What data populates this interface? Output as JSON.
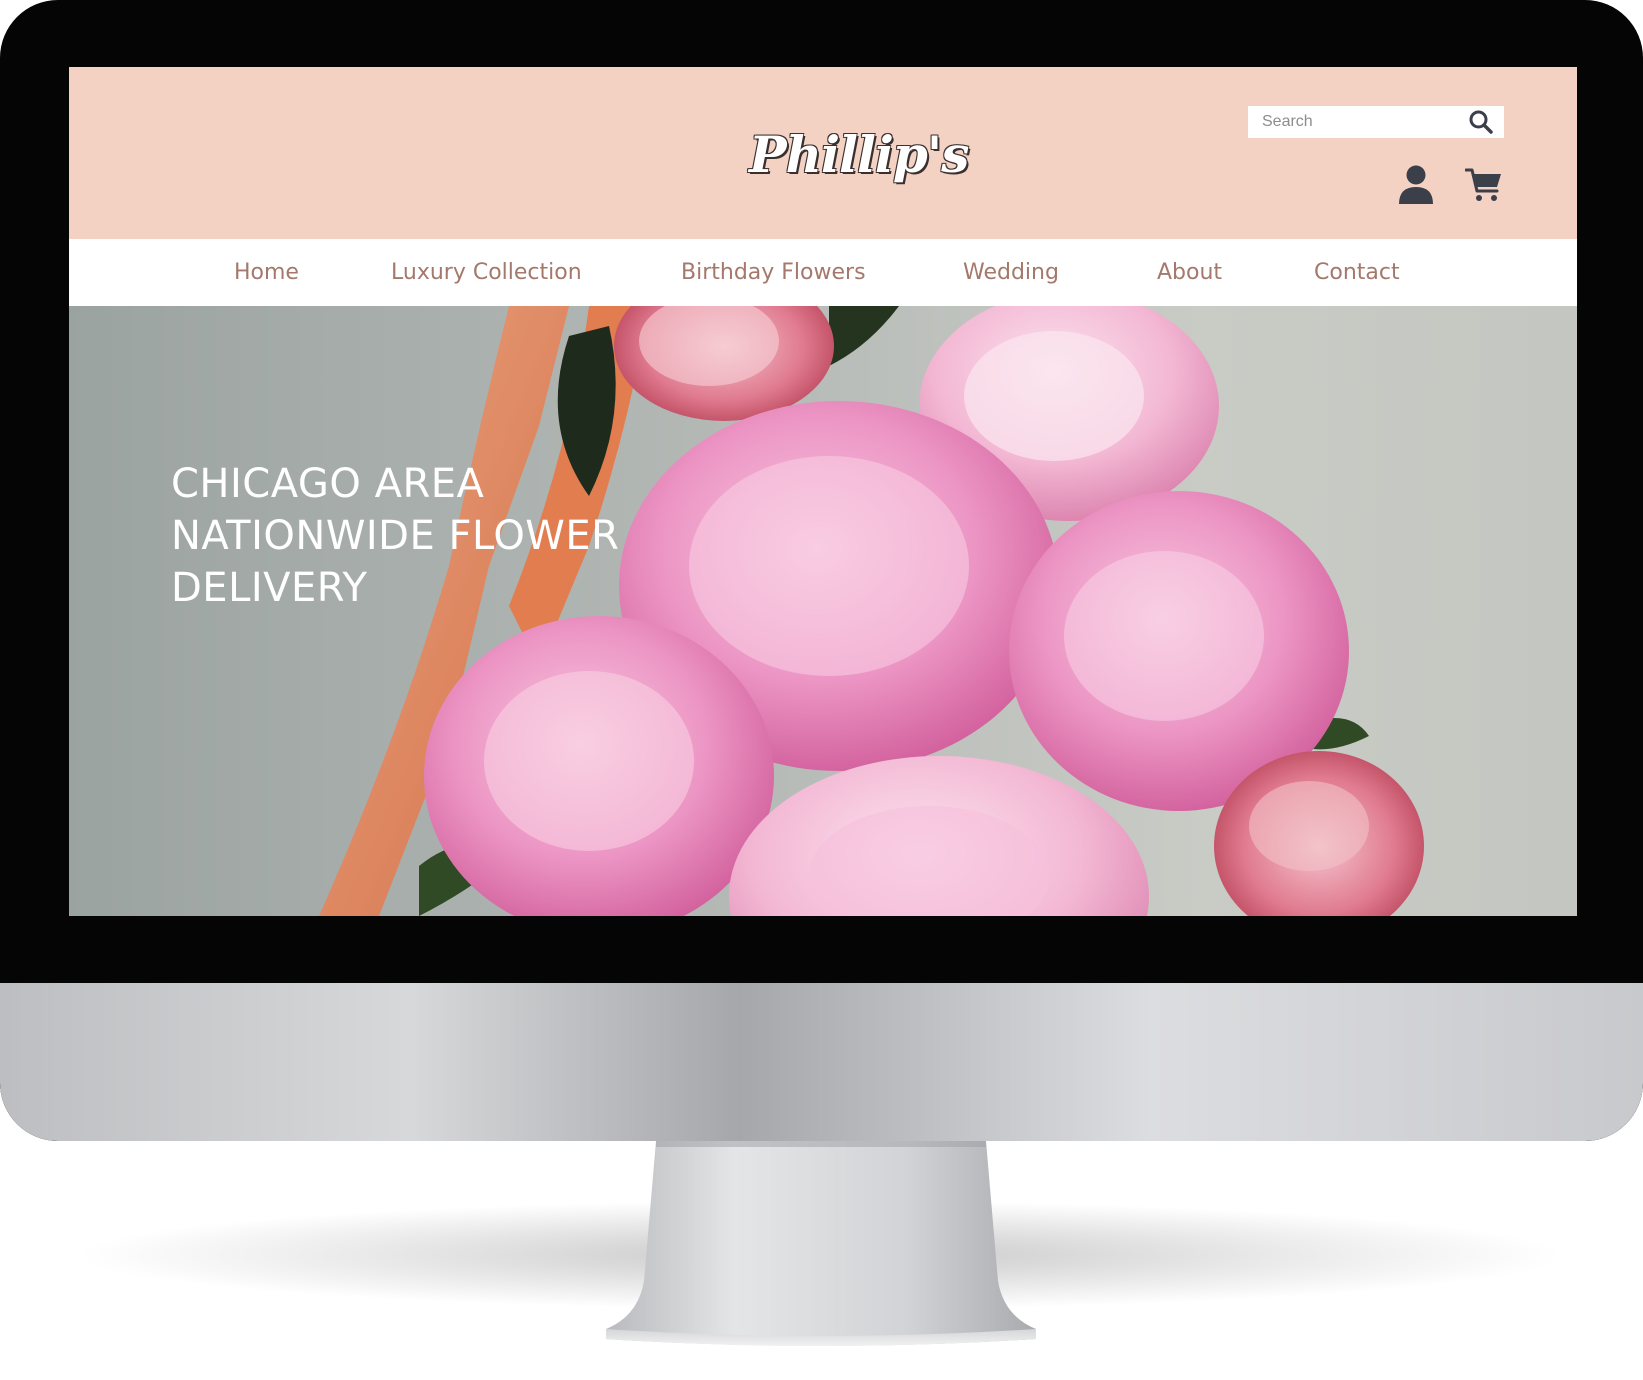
{
  "brand": {
    "logo_text": "Phillip's"
  },
  "search": {
    "placeholder": "Search"
  },
  "icons": {
    "search": "search-icon",
    "account": "user-icon",
    "cart": "cart-icon"
  },
  "nav": {
    "items": [
      {
        "label": "Home"
      },
      {
        "label": "Luxury Collection"
      },
      {
        "label": "Birthday Flowers"
      },
      {
        "label": "Wedding"
      },
      {
        "label": "About"
      },
      {
        "label": "Contact"
      }
    ]
  },
  "hero": {
    "lines": [
      "CHICAGO AREA",
      "NATIONWIDE FLOWER",
      "DELIVERY"
    ]
  },
  "colors": {
    "header_bg": "#f3d2c3",
    "nav_text": "#a4796b",
    "icon": "#3a3f4a"
  }
}
